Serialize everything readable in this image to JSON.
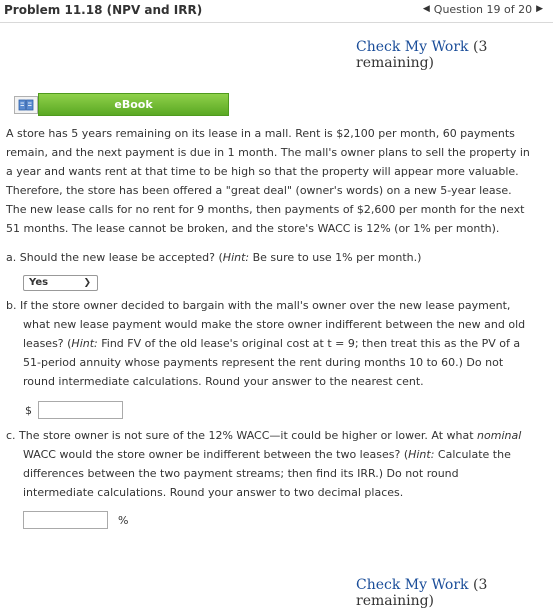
{
  "header": {
    "title": "Problem 11.18 (NPV and IRR)",
    "question_progress": "Question 19 of 20"
  },
  "check_work": {
    "label": "Check My Work",
    "remaining": "(3 remaining)"
  },
  "ebook": {
    "label": "eBook"
  },
  "problem": {
    "lines": [
      "A store has 5 years remaining on its lease in a mall. Rent is $2,100 per month, 60 payments",
      "remain, and the next payment is due in 1 month. The mall's owner plans to sell the property in",
      "a year and wants rent at that time to be high so that the property will appear more valuable.",
      "Therefore, the store has been offered a \"great deal\" (owner's words) on a new 5-year lease.",
      "The new lease calls for no rent for 9 months, then payments of $2,600 per month for the next",
      "51 months. The lease cannot be broken, and the store's WACC is 12% (or 1% per month)."
    ]
  },
  "part_a": {
    "prefix": "a. Should the new lease be accepted? (",
    "hint": "Hint:",
    "suffix": " Be sure to use 1% per month.)",
    "selected": "Yes"
  },
  "part_b": {
    "line1": "b. If the store owner decided to bargain with the mall's owner over the new lease payment,",
    "line2": "what new lease payment would make the store owner indifferent between the new and old",
    "line3_pre": "leases? (",
    "line3_hint": "Hint:",
    "line3_post": " Find FV of the old lease's original cost at t = 9; then treat this as the PV of a",
    "line4": "51-period annuity whose payments represent the rent during months 10 to 60.) Do not",
    "line5": "round intermediate calculations. Round your answer to the nearest cent.",
    "currency": "$",
    "value": ""
  },
  "part_c": {
    "line1_pre": "c. The store owner is not sure of the 12% WACC—it could be higher or lower. At what ",
    "line1_em": "nominal",
    "line2_pre": "WACC would the store owner be indifferent between the two leases? (",
    "line2_hint": "Hint:",
    "line2_post": " Calculate the",
    "line3": "differences between the two payment streams; then find its IRR.) Do not round",
    "line4": "intermediate calculations. Round your answer to two decimal places.",
    "unit": "%",
    "value": ""
  }
}
